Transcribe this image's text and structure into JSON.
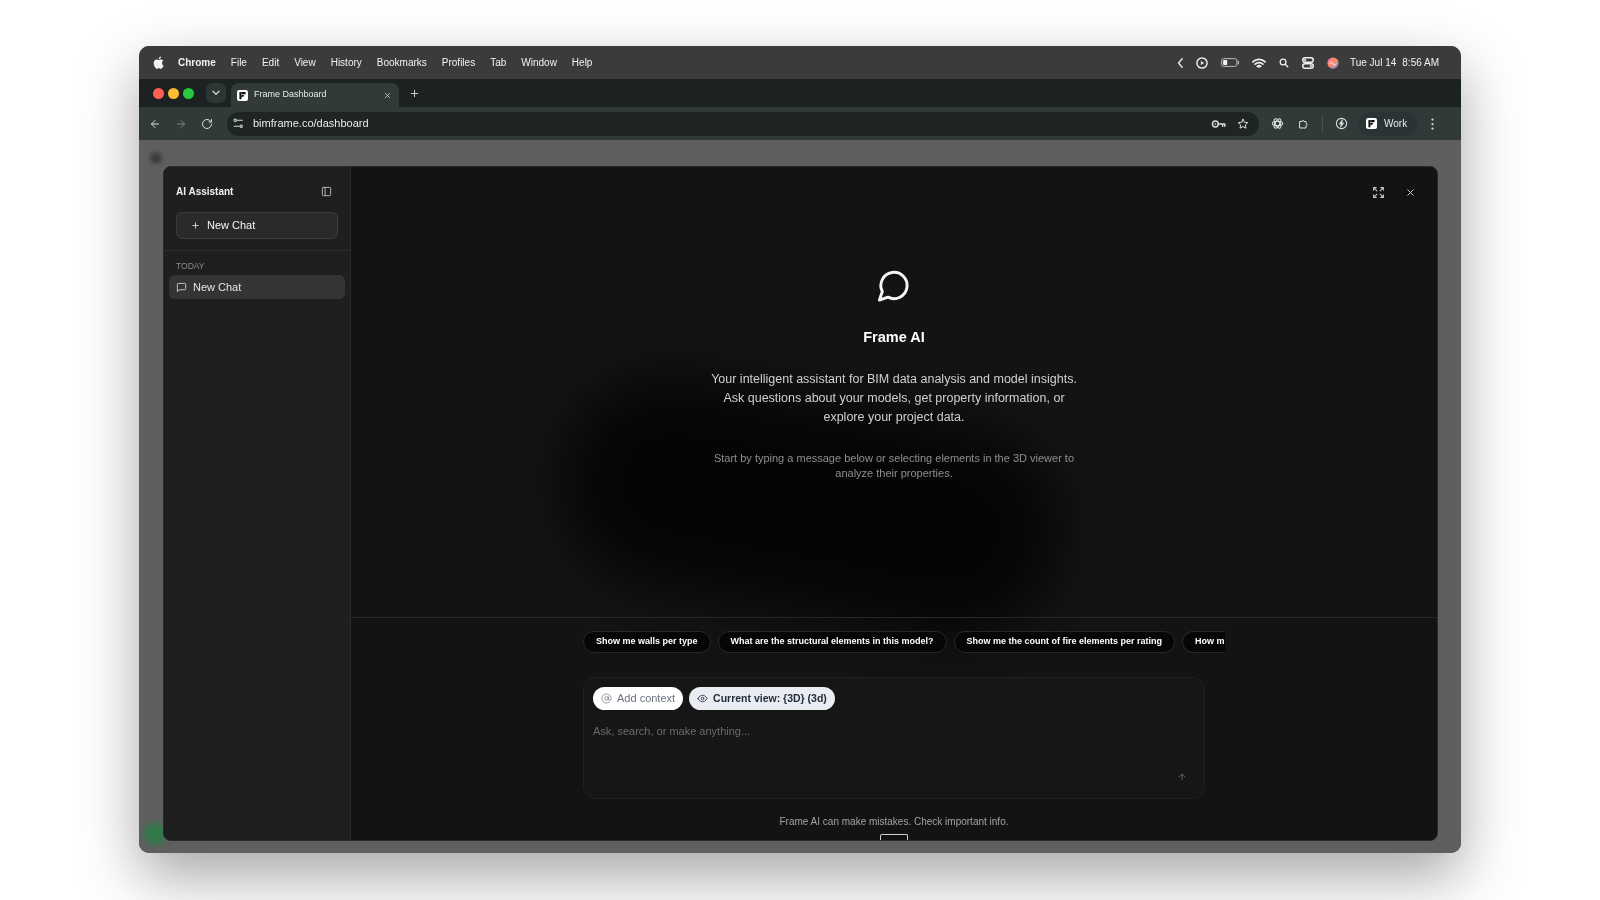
{
  "menu_bar": {
    "app_name": "Chrome",
    "items": [
      "File",
      "Edit",
      "View",
      "History",
      "Bookmarks",
      "Profiles",
      "Tab",
      "Window",
      "Help"
    ],
    "date": "Tue Jul 14",
    "time": "8:56 AM"
  },
  "browser": {
    "tabs": [
      {
        "title": "Frame Dashboard",
        "selected": true
      }
    ],
    "address": "bimframe.co/dashboard",
    "profile": "Work"
  },
  "assistant": {
    "sidebar": {
      "title": "AI Assistant",
      "new_chat_button": "New Chat",
      "sections": [
        {
          "heading": "TODAY",
          "items": [
            {
              "label": "New Chat",
              "selected": true
            }
          ]
        }
      ]
    },
    "empty_state": {
      "title": "Frame AI",
      "description": "Your intelligent assistant for BIM data analysis and model insights. Ask questions about your models, get property information, or explore your project data.",
      "hint": "Start by typing a message below or selecting elements in the 3D viewer to analyze their properties."
    },
    "suggestions": [
      "Show me walls per type",
      "What are the structural elements in this model?",
      "Show me the count of fire elements per rating",
      "How m"
    ],
    "composer": {
      "context_chips": [
        {
          "kind": "add",
          "label": "Add context"
        },
        {
          "kind": "view",
          "label": "Current view: {3D} (3d)"
        }
      ],
      "placeholder": "Ask, search, or make anything..."
    },
    "disclaimer": "Frame AI can make mistakes. Check important info."
  }
}
